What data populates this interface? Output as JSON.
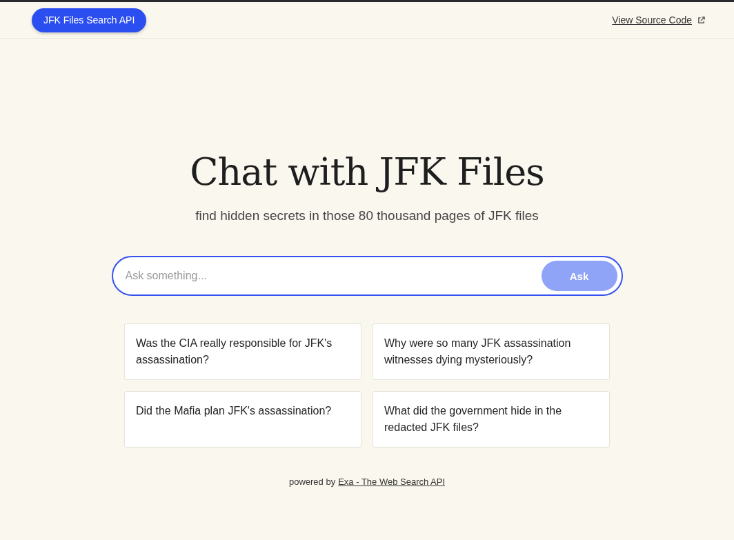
{
  "header": {
    "brand_button": "JFK Files Search API",
    "source_link": "View Source Code"
  },
  "hero": {
    "title": "Chat with JFK Files",
    "subtitle": "find hidden secrets in those 80 thousand pages of JFK files"
  },
  "search": {
    "placeholder": "Ask something...",
    "button": "Ask",
    "disabled": true
  },
  "suggestions": [
    "Was the CIA really responsible for JFK's assassination?",
    "Why were so many JFK assassination witnesses dying mysteriously?",
    "Did the Mafia plan JFK's assassination?",
    "What did the government hide in the redacted JFK files?"
  ],
  "footer": {
    "prefix": "powered by",
    "link": "Exa - The Web Search API"
  }
}
